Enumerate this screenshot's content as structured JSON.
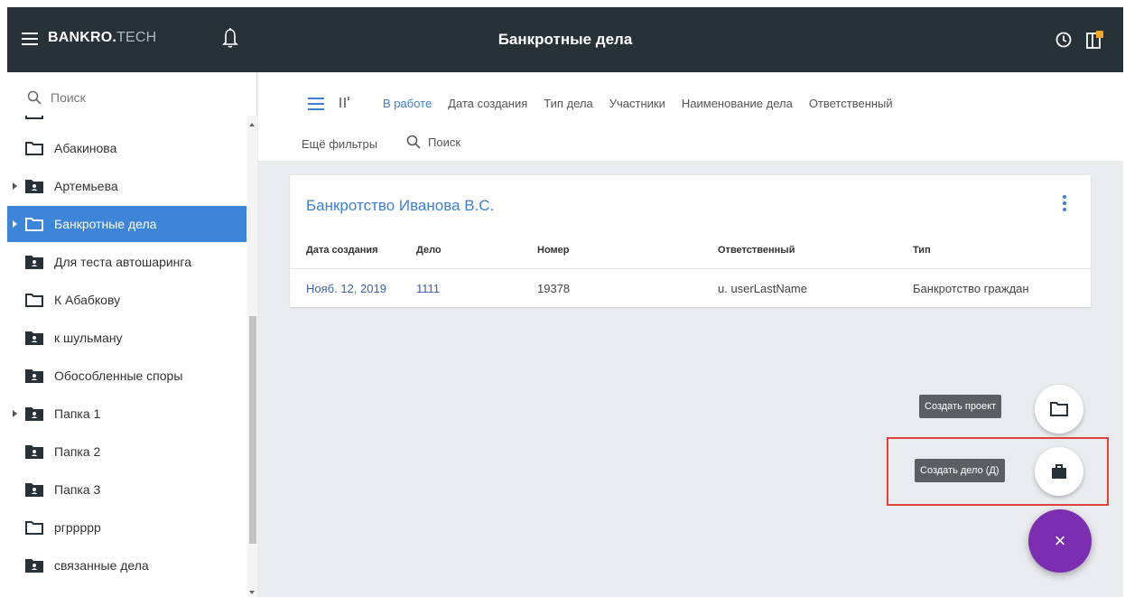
{
  "app": {
    "brand_bold": "BANKRO.",
    "brand_light": "TECH",
    "page_title": "Банкротные дела",
    "colors": {
      "topbar": "#263238",
      "accent": "#3d7fd3",
      "active_item": "#3d85d8",
      "fab": "#7b2eb0",
      "highlight": "#e0403a"
    }
  },
  "sidebar": {
    "search_label": "Поиск",
    "items": [
      {
        "label": "Абакинова",
        "expandable": false,
        "icon": "folder-outline-icon"
      },
      {
        "label": "Артемьева",
        "expandable": true,
        "icon": "shared-folder-icon"
      },
      {
        "label": "Банкротные дела",
        "expandable": true,
        "icon": "folder-outline-icon",
        "active": true
      },
      {
        "label": "Для теста автошаринга",
        "expandable": false,
        "icon": "shared-folder-icon"
      },
      {
        "label": "К Абабкову",
        "expandable": false,
        "icon": "folder-outline-icon"
      },
      {
        "label": "к шульману",
        "expandable": false,
        "icon": "shared-folder-icon"
      },
      {
        "label": "Обособленные споры",
        "expandable": false,
        "icon": "shared-folder-icon"
      },
      {
        "label": "Папка 1",
        "expandable": true,
        "icon": "shared-folder-icon"
      },
      {
        "label": "Папка 2",
        "expandable": false,
        "icon": "shared-folder-icon"
      },
      {
        "label": "Папка 3",
        "expandable": false,
        "icon": "shared-folder-icon"
      },
      {
        "label": "ргрpppp",
        "expandable": false,
        "icon": "folder-outline-icon"
      },
      {
        "label": "связанные дела",
        "expandable": false,
        "icon": "shared-folder-icon"
      }
    ]
  },
  "filters": {
    "items": [
      "В работе",
      "Дата создания",
      "Тип дела",
      "Участники",
      "Наименование дела",
      "Ответственный"
    ],
    "more": "Ещё фильтры",
    "search": "Поиск"
  },
  "card": {
    "title": "Банкротство Иванова В.С.",
    "columns": [
      "Дата создания",
      "Дело",
      "Номер",
      "Ответственный",
      "Тип"
    ],
    "row": [
      "Нояб. 12, 2019",
      "1111",
      "19378",
      "u. userLastName",
      "Банкротство граждан"
    ]
  },
  "fab": {
    "create_project": "Создать проект",
    "create_case": "Создать дело (Д)",
    "close_glyph": "×"
  }
}
